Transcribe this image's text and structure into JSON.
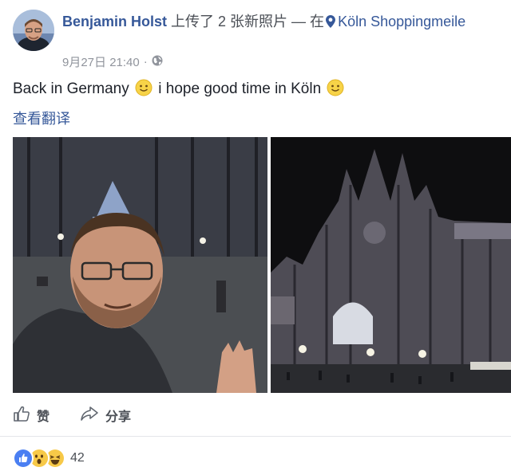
{
  "post": {
    "author": "Benjamin Holst",
    "action": "上传了 2 张新照片 — 在",
    "location": "Köln Shoppingmeile",
    "timestamp": "9月27日 21:40",
    "privacy_icon": "globe-icon",
    "text_part1": "Back in Germany",
    "text_part2": "i hope good time in Köln",
    "translate_link": "查看翻译"
  },
  "actions": {
    "like_label": "赞",
    "share_label": "分享"
  },
  "reactions": {
    "icons": [
      "like-icon",
      "wow-icon",
      "haha-icon"
    ],
    "count": "42"
  },
  "colors": {
    "link": "#365899",
    "text": "#1d2129",
    "meta": "#90949c",
    "like_blue": "#4267b2"
  }
}
